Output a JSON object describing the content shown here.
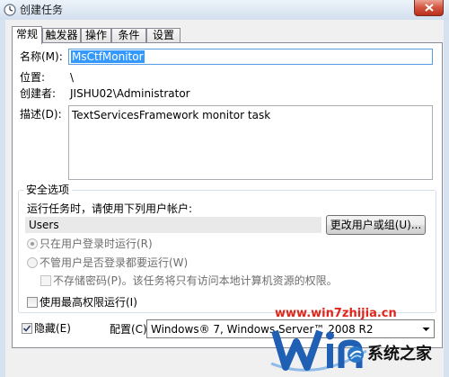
{
  "window": {
    "title": "创建任务",
    "icon": "clock-icon",
    "close_icon": "close-icon"
  },
  "tabs": [
    {
      "label": "常规",
      "selected": true
    },
    {
      "label": "触发器",
      "selected": false
    },
    {
      "label": "操作",
      "selected": false
    },
    {
      "label": "条件",
      "selected": false
    },
    {
      "label": "设置",
      "selected": false
    }
  ],
  "general": {
    "name_label": "名称(M):",
    "name_value": "MsCtfMonitor",
    "location_label": "位置:",
    "location_value": "\\",
    "author_label": "创建者:",
    "author_value": "JISHU02\\Administrator",
    "description_label": "描述(D):",
    "description_value": "TextServicesFramework monitor task"
  },
  "security": {
    "group_label": "安全选项",
    "run_as_prompt": "运行任务时，请使用下列用户帐户:",
    "user_account": "Users",
    "change_user_button": "更改用户或组(U)...",
    "radio_logged_on_label": "只在用户登录时运行(R)",
    "radio_logged_on_selected": true,
    "radio_whether_logged_label": "不管用户是否登录都要运行(W)",
    "radio_whether_logged_selected": false,
    "no_password_label": "不存储密码(P)。该任务将只有访问本地计算机资源的权限。",
    "no_password_checked": false,
    "highest_privileges_label": "使用最高权限运行(I)",
    "highest_privileges_checked": false
  },
  "footer": {
    "hidden_label": "隐藏(E)",
    "hidden_checked": true,
    "configure_label": "配置(C):",
    "configure_value": "Windows® 7, Windows Server™ 2008 R2"
  },
  "watermark": {
    "url": "www.win7zhijia.cn",
    "logo_text": "系统之家"
  },
  "colors": {
    "selection": "#3399ff",
    "watermark": "#e0261b",
    "close_button": "#d2543f",
    "logo_blue": "#1f5fb4"
  }
}
